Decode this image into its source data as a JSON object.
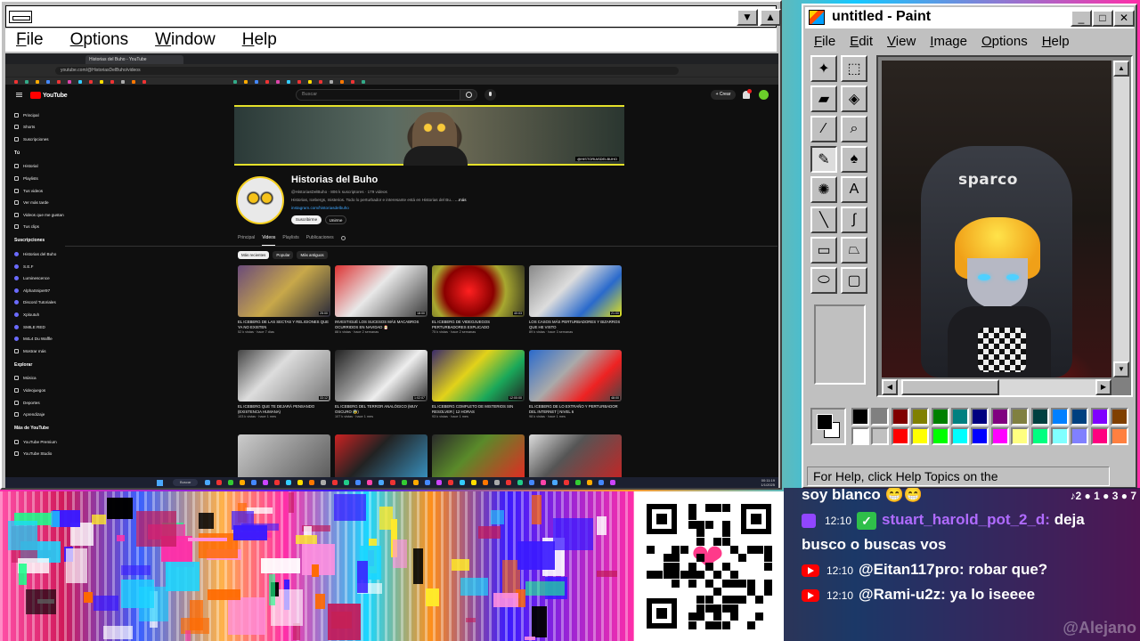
{
  "left_window": {
    "menu": [
      "File",
      "Options",
      "Window",
      "Help"
    ],
    "browser": {
      "tab_title": "Historias del Buho - YouTube",
      "url": "youtube.com/@HistoriasDelBuho/videos"
    },
    "youtube": {
      "logo": "YouTube",
      "search_placeholder": "Buscar",
      "create_label": "+ Crear",
      "sidebar": {
        "main": [
          "Principal",
          "Shorts",
          "Suscripciones"
        ],
        "you_header": "Tú",
        "you": [
          "Historial",
          "Playlists",
          "Tus videos",
          "Ver más tarde",
          "Videos que me gustan",
          "Tus clips"
        ],
        "subs_header": "Suscripciones",
        "subs": [
          "Historias del Buho",
          "S.E.F",
          "Luminescence",
          "AlphaSniper97",
          "Discord Tutoriales",
          "Xploutuh",
          "SMILE RED",
          "M4L4 Du Waffle",
          "Mostrar más"
        ],
        "explore_header": "Explorar",
        "explore": [
          "Música",
          "Videojuegos",
          "Deportes",
          "Aprendizaje"
        ],
        "more_header": "Más de YouTube",
        "more": [
          "YouTube Premium",
          "YouTube Studio"
        ]
      },
      "channel": {
        "banner_handle": "@HISTORIASDELBUHO",
        "name": "Historias del Buho",
        "meta": "@HistoriasDelBuho · 806 k suscriptores · 179 videos",
        "desc": "Historias, Icebergs, misterios. Todo lo perturbador e interesante está en Historias del Bu...",
        "desc_more": "...más",
        "link": "instagram.com/historiasdelbuho",
        "subscribe": "Suscribirme",
        "join": "Unirme",
        "tabs": [
          "Principal",
          "Videos",
          "Playlists",
          "Publicaciones"
        ],
        "active_tab": "Videos",
        "chips": [
          "Más recientes",
          "Popular",
          "Más antiguos"
        ]
      },
      "videos": [
        {
          "title": "EL ICEBERG DE LAS SECTAS Y RELIGIONES QUE YA NO EXISTEN",
          "meta": "52 k vistas · hace 7 días",
          "duration": "25:00"
        },
        {
          "title": "INVESTIGUÉ LOS SUCESOS MÁS MACABROS OCURRIDOS EN NAVIDAD 🎅",
          "meta": "88 k vistas · hace 2 semanas",
          "duration": "18:00"
        },
        {
          "title": "EL ICEBERG DE VIDEOJUEGOS PERTURBADORES EXPLICADO",
          "meta": "75 k vistas · hace 2 semanas",
          "duration": "40:03"
        },
        {
          "title": "LOS CASOS MÁS PERTURBADORES Y BIZARROS QUE HE VISTO",
          "meta": "89 k vistas · hace 3 semanas",
          "duration": "21:00"
        },
        {
          "title": "EL ICEBERG QUE TE DEJARÁ PENSANDO (EXISTENCIA HUMANA)",
          "meta": "103 k vistas · hace 1 mes",
          "duration": "33:12"
        },
        {
          "title": "EL ICEBERG DEL TERROR ANALÓGICO (MUY OSCURO 😰)",
          "meta": "107 k vistas · hace 1 mes",
          "duration": "1:02:07"
        },
        {
          "title": "EL ICEBERG COMPLETO DE MISTERIOS SIN RESOLVER | 12 HORAS",
          "meta": "93 k vistas · hace 1 mes",
          "duration": "12:00:00"
        },
        {
          "title": "EL ICEBERG DE LO EXTRAÑO Y PERTURBADOR DEL INTERNET | NIVEL 6",
          "meta": "98 k vistas · hace 1 mes",
          "duration": "48:00"
        },
        {
          "title": "",
          "meta": "",
          "duration": ""
        },
        {
          "title": "",
          "meta": "",
          "duration": ""
        },
        {
          "title": "",
          "meta": "",
          "duration": ""
        },
        {
          "title": "",
          "meta": "",
          "duration": ""
        }
      ],
      "taskbar": {
        "search": "Buscar",
        "time": "00:11:19",
        "date": "1/1/2025"
      }
    }
  },
  "paint": {
    "title": "untitled - Paint",
    "menu": [
      "File",
      "Edit",
      "View",
      "Image",
      "Options",
      "Help"
    ],
    "canvas_logo_text": "sparco",
    "status": "For Help, click Help Topics on the",
    "palette": [
      "#000000",
      "#808080",
      "#800000",
      "#808000",
      "#008000",
      "#008080",
      "#000080",
      "#800080",
      "#808040",
      "#004040",
      "#0080ff",
      "#004080",
      "#8000ff",
      "#804000",
      "#ffffff",
      "#c0c0c0",
      "#ff0000",
      "#ffff00",
      "#00ff00",
      "#00ffff",
      "#0000ff",
      "#ff00ff",
      "#ffff80",
      "#00ff80",
      "#80ffff",
      "#8080ff",
      "#ff0080",
      "#ff8040"
    ]
  },
  "chat": {
    "counters": "♪2 ● 1 ● 3 ● 7",
    "lines": [
      {
        "platform": "none",
        "time": "",
        "user": "",
        "text": "soy blanco 😁😁"
      },
      {
        "platform": "twitch",
        "time": "12:10",
        "user": "stuart_harold_pot_2_d:",
        "text": "deja"
      },
      {
        "platform": "none",
        "time": "",
        "user": "",
        "text": "busco o buscas vos"
      },
      {
        "platform": "youtube",
        "time": "12:10",
        "user": "@Eitan117pro:",
        "text": "robar que?"
      },
      {
        "platform": "youtube",
        "time": "12:10",
        "user": "@Rami-u2z:",
        "text": "ya lo iseeee"
      }
    ],
    "watermark": "@Alejano"
  }
}
